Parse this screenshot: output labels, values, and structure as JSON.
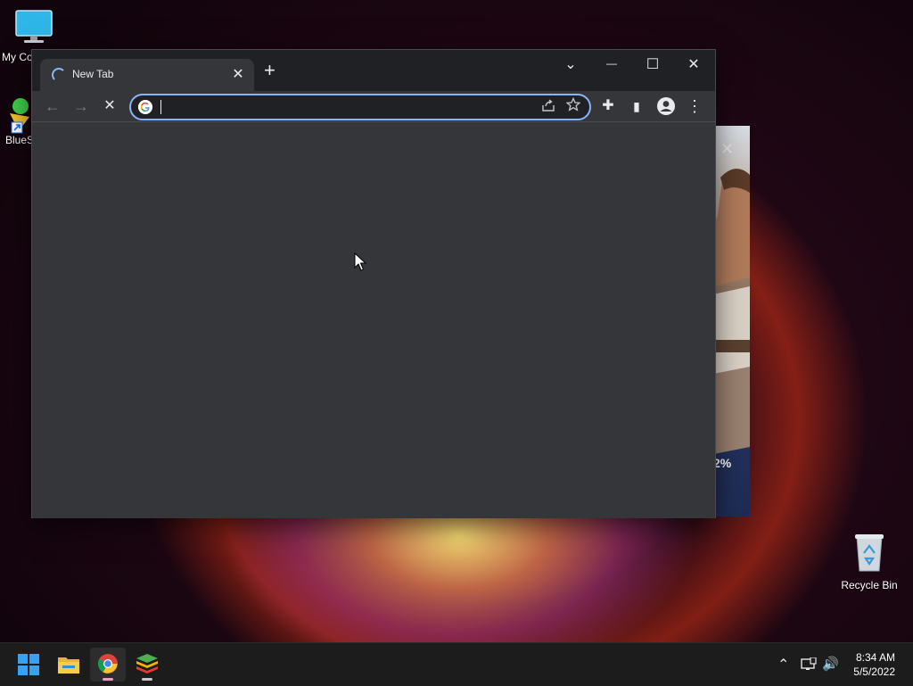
{
  "desktop": {
    "icons": [
      {
        "label": "My Co",
        "icon": "monitor-icon"
      },
      {
        "label": "BlueSt",
        "icon": "bluestacks-shortcut-icon"
      },
      {
        "label": "Recycle Bin",
        "icon": "recycle-bin-icon"
      }
    ]
  },
  "popup_behind": {
    "close_glyph": "✕",
    "percent_text": "2%"
  },
  "browser": {
    "tab": {
      "title": "New Tab",
      "close_glyph": "✕"
    },
    "new_tab_glyph": "+",
    "window_controls": {
      "dropdown": "⌄",
      "minimize": "—",
      "maximize": "☐",
      "close": "✕"
    },
    "toolbar": {
      "back": "←",
      "forward": "→",
      "stop": "✕",
      "omnibox_value": "",
      "extensions": "✚",
      "side_panel": "▮",
      "menu": "⋮"
    }
  },
  "taskbar": {
    "apps": [
      "windows-start",
      "file-explorer",
      "chrome",
      "bluestacks"
    ],
    "tray": {
      "chevron": "⌃",
      "network": "network-icon",
      "volume": "🔊"
    },
    "clock": {
      "time": "8:34 AM",
      "date": "5/5/2022"
    }
  },
  "colors": {
    "accent": "#8ab4f8",
    "browser_bg": "#35363a",
    "titlebar_bg": "#202124",
    "taskbar_bg": "#1c1c1c"
  }
}
